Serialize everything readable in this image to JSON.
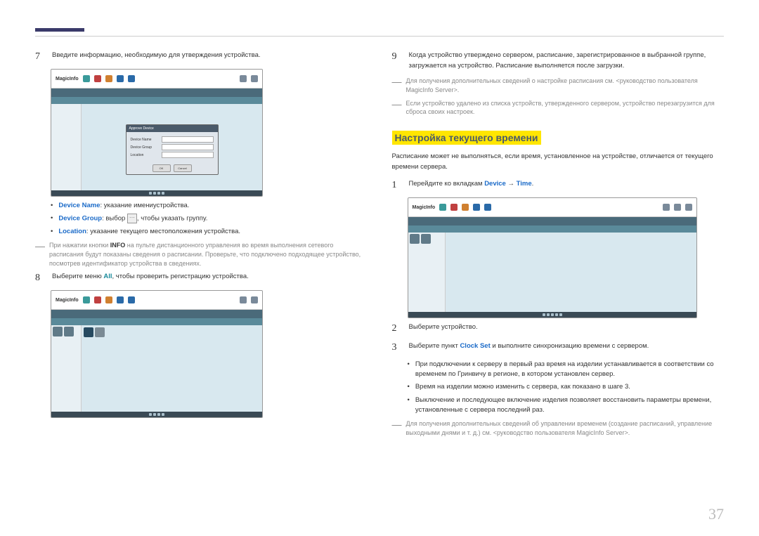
{
  "page_number": "37",
  "left": {
    "step7": {
      "num": "7",
      "text": "Введите информацию, необходимую для утверждения устройства."
    },
    "modal": {
      "title": "Approve Device",
      "device_name": "Device Name",
      "device_group": "Device Group",
      "location": "Location",
      "ok": "OK",
      "cancel": "Cancel"
    },
    "bullets": {
      "device_name_term": "Device Name",
      "device_name_text": ": указание имениустройства.",
      "device_group_term": "Device Group",
      "device_group_text1": ": выбор ",
      "device_group_text2": ", чтобы указать группу.",
      "location_term": "Location",
      "location_text": ": указание текущего местоположения устройства."
    },
    "note1_prefix": "При нажатии кнопки ",
    "note1_bold": "INFO",
    "note1_suffix": " на пульте дистанционного управления во время выполнения сетевого расписания будут показаны сведения о расписании. Проверьте, что подключено подходящее устройство, посмотрев идентификатор устройства в сведениях.",
    "step8": {
      "num": "8",
      "text_prefix": "Выберите меню ",
      "text_bold": "All",
      "text_suffix": ", чтобы проверить регистрацию устройства."
    }
  },
  "right": {
    "step9": {
      "num": "9",
      "text": "Когда устройство утверждено сервером, расписание, зарегистрированное в выбранной группе, загружается на устройство. Расписание выполняется после загрузки."
    },
    "note1": "Для получения дополнительных сведений о настройке расписания см. <руководство пользователя MagicInfo Server>.",
    "note2": "Если устройство удалено из списка устройств, утвержденного сервером, устройство перезагрузится для сброса своих настроек.",
    "heading": "Настройка текущего времени",
    "intro": "Расписание может не выполняться, если время, установленное на устройстве, отличается от текущего времени сервера.",
    "step1": {
      "num": "1",
      "text_prefix": "Перейдите ко вкладкам ",
      "text_device": "Device",
      "text_arrow": " → ",
      "text_time": "Time",
      "text_suffix": "."
    },
    "step2": {
      "num": "2",
      "text": "Выберите устройство."
    },
    "step3": {
      "num": "3",
      "text_prefix": "Выберите пункт ",
      "text_bold": "Clock Set",
      "text_suffix": " и выполните синхронизацию времени с сервером."
    },
    "bullet1": "При подключении к серверу в первый раз время на изделии устанавливается в соответствии со временем по Гринвичу в регионе, в котором установлен сервер.",
    "bullet2": "Время на изделии можно изменить с сервера, как показано в шаге 3.",
    "bullet3": "Выключение и последующее включение изделия позволяет восстановить параметры времени, установленные с сервера последний раз.",
    "note3": "Для получения дополнительных сведений об управлении временем (создание расписаний, управление выходными днями и т. д.) см. <руководство пользователя MagicInfo Server>."
  },
  "screenshot_label": "MagicInfo"
}
